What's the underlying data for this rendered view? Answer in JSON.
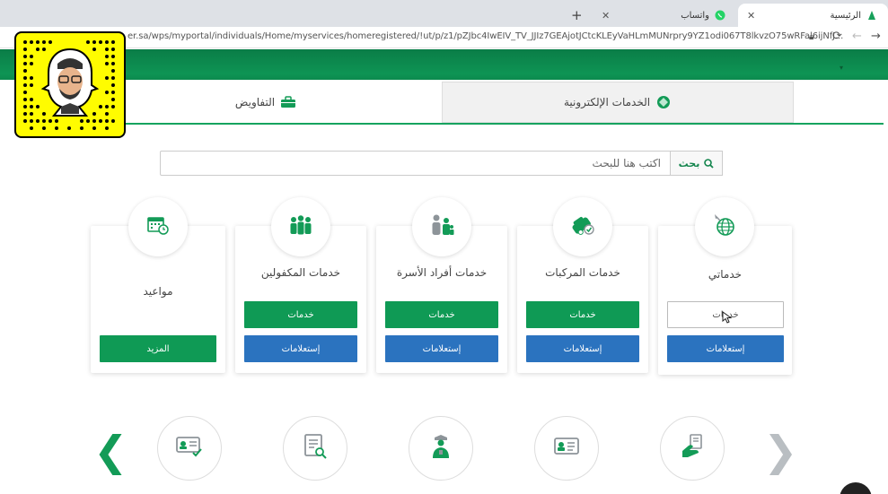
{
  "browser": {
    "tabs": [
      {
        "label": "الرئيسية",
        "active": true
      },
      {
        "label": "واتساب",
        "active": false
      }
    ],
    "url": "er.sa/wps/myportal/individuals/Home/myservices/homeregistered/!ut/p/z1/pZJbc4IwEIV_TV_JJIz7GEAjotJCtcKLEyVaHLmMUNrpry9YZ1odi067T8lkvzO75wRFal6ijNfJ..."
  },
  "tabs": {
    "left": "التفاويض",
    "right": "الخدمات الإلكترونية"
  },
  "search": {
    "placeholder": "اكتب هنا للبحث",
    "button_label": "بحث"
  },
  "cards": [
    {
      "key": "appointments",
      "title": "مواعيد",
      "more": "المزيد"
    },
    {
      "key": "sponsored",
      "title": "خدمات المكفولين",
      "services": "خدمات",
      "inquiries": "إستعلامات"
    },
    {
      "key": "family",
      "title": "خدمات أفراد الأسرة",
      "services": "خدمات",
      "inquiries": "إستعلامات"
    },
    {
      "key": "vehicles",
      "title": "خدمات المركبات",
      "services": "خدمات",
      "inquiries": "إستعلامات"
    },
    {
      "key": "myservices",
      "title": "خدماتي",
      "services": "خدمات",
      "inquiries": "إستعلامات"
    }
  ],
  "colors": {
    "brand_green": "#0f9a55",
    "brand_blue": "#2b73bf",
    "snapcode_yellow": "#fffc00"
  }
}
